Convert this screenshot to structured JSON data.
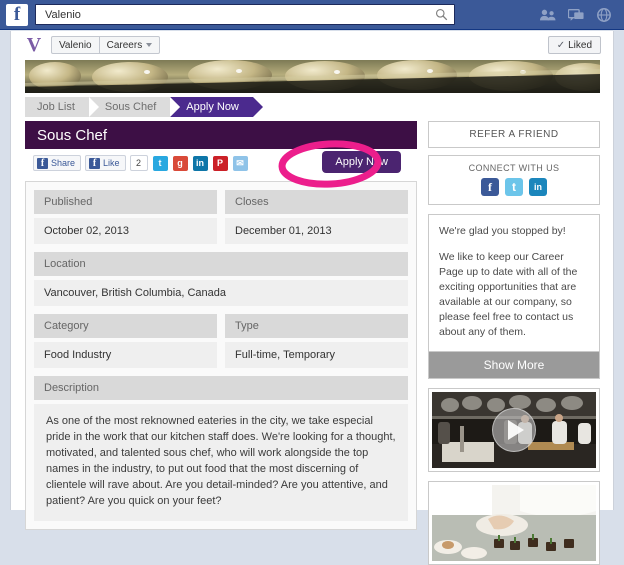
{
  "facebook_bar": {
    "logo": "f",
    "search_value": "Valenio",
    "search_placeholder": "Search",
    "icons": [
      "friend-requests-icon",
      "messages-icon",
      "notifications-globe-icon"
    ]
  },
  "page_tabs": {
    "brand_initial": "V",
    "tabs": [
      {
        "label": "Valenio"
      },
      {
        "label": "Careers",
        "has_caret": true
      }
    ],
    "liked_button": {
      "check": "✓",
      "label": "Liked"
    }
  },
  "breadcrumb": {
    "items": [
      {
        "label": "Job List",
        "active": false
      },
      {
        "label": "Sous Chef",
        "active": false
      },
      {
        "label": "Apply Now",
        "active": true
      }
    ]
  },
  "job": {
    "title": "Sous Chef",
    "share": {
      "fb_share_label": "Share",
      "fb_like_label": "Like",
      "like_count": "2",
      "buttons": [
        "twitter-icon",
        "google-plus-icon",
        "linkedin-icon",
        "pinterest-icon",
        "email-icon"
      ]
    },
    "apply_button": "Apply Now",
    "fields": [
      {
        "label": "Published",
        "value": "October 02, 2013"
      },
      {
        "label": "Closes",
        "value": "December 01, 2013"
      },
      {
        "label": "Location",
        "value": "Vancouver, British Columbia, Canada"
      },
      {
        "label": "Category",
        "value": "Food Industry"
      },
      {
        "label": "Type",
        "value": "Full-time, Temporary"
      }
    ],
    "description_label": "Description",
    "description": "As one of the most reknowned eateries in the city, we take especial pride in the work that our kitchen staff does. We're looking for a thought, motivated, and talented sous chef, who will work alongside the top names in the industry, to put out food that the most discerning of clientele will rave about. Are you detail-minded? Are you attentive, and patient? Are you quick on your feet?"
  },
  "sidebar": {
    "refer_button": "REFER A FRIEND",
    "connect_heading": "CONNECT WITH US",
    "connect_icons": [
      {
        "name": "facebook-icon",
        "glyph": "f"
      },
      {
        "name": "twitter-icon",
        "glyph": "t"
      },
      {
        "name": "linkedin-icon",
        "glyph": "in"
      }
    ],
    "blurb_line1": "We're glad you stopped by!",
    "blurb_line2": "We like to keep our Career Page up to date with all of the exciting opportunities that are available at our company, so please feel free to contact us about any of them.",
    "show_more": "Show More",
    "media": [
      {
        "name": "kitchen-video-thumbnail",
        "has_play": true
      },
      {
        "name": "plating-photo-thumbnail",
        "has_play": false
      }
    ]
  },
  "annotation": {
    "type": "highlight-ellipse",
    "target": "apply-now-button",
    "color": "#ec1e8c"
  },
  "colors": {
    "facebook_blue": "#3b5998",
    "brand_purple_dark": "#3d0f45",
    "breadcrumb_purple": "#4b2a8e",
    "apply_purple": "#4b2470",
    "annotation_pink": "#ec1e8c"
  }
}
